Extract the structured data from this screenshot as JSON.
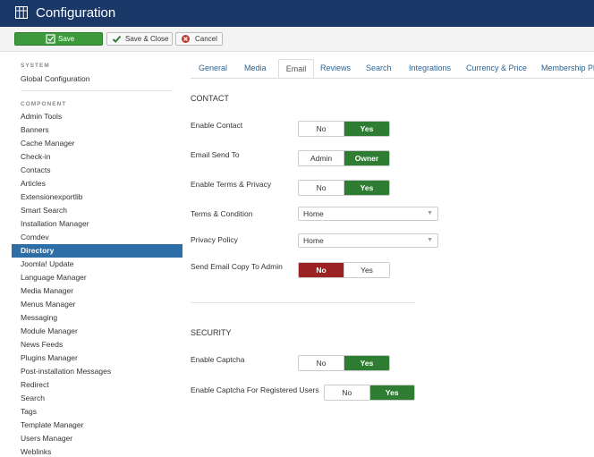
{
  "header": {
    "title": "Configuration"
  },
  "toolbar": {
    "save_label": "Save",
    "save_close_label": "Save & Close",
    "cancel_label": "Cancel"
  },
  "sidebar": {
    "system_heading": "SYSTEM",
    "global_config": "Global Configuration",
    "component_heading": "COMPONENT",
    "items": [
      "Admin Tools",
      "Banners",
      "Cache Manager",
      "Check-in",
      "Contacts",
      "Articles",
      "Extensionexportlib",
      "Smart Search",
      "Installation Manager",
      "Comdev",
      "Directory",
      "Joomla! Update",
      "Language Manager",
      "Media Manager",
      "Menus Manager",
      "Messaging",
      "Module Manager",
      "News Feeds",
      "Plugins Manager",
      "Post-installation Messages",
      "Redirect",
      "Search",
      "Tags",
      "Template Manager",
      "Users Manager",
      "Weblinks"
    ],
    "active_index": 10
  },
  "tabs": [
    "General",
    "Media",
    "Email",
    "Reviews",
    "Search",
    "Integrations",
    "Currency & Price",
    "Membership Pla"
  ],
  "active_tab": 2,
  "contact": {
    "title": "CONTACT",
    "enable_contact": {
      "label": "Enable Contact",
      "opt1": "No",
      "opt2": "Yes",
      "selected": "Yes"
    },
    "email_send_to": {
      "label": "Email Send To",
      "opt1": "Admin",
      "opt2": "Owner",
      "selected": "Owner"
    },
    "enable_terms": {
      "label": "Enable Terms & Privacy",
      "opt1": "No",
      "opt2": "Yes",
      "selected": "Yes"
    },
    "terms_condition": {
      "label": "Terms & Condition",
      "value": "Home"
    },
    "privacy_policy": {
      "label": "Privacy Policy",
      "value": "Home"
    },
    "send_copy": {
      "label": "Send Email Copy To Admin",
      "opt1": "No",
      "opt2": "Yes",
      "selected": "No"
    }
  },
  "security": {
    "title": "SECURITY",
    "enable_captcha": {
      "label": "Enable Captcha",
      "opt1": "No",
      "opt2": "Yes",
      "selected": "Yes"
    },
    "captcha_registered": {
      "label": "Enable Captcha For Registered Users",
      "opt1": "No",
      "opt2": "Yes",
      "selected": "Yes"
    }
  },
  "colors": {
    "header": "#1a3867",
    "save": "#3c9a3c",
    "toggle_on": "#2f7d32",
    "toggle_off_red": "#9b2222",
    "active_item": "#2e6ea6",
    "link": "#2a6496"
  }
}
